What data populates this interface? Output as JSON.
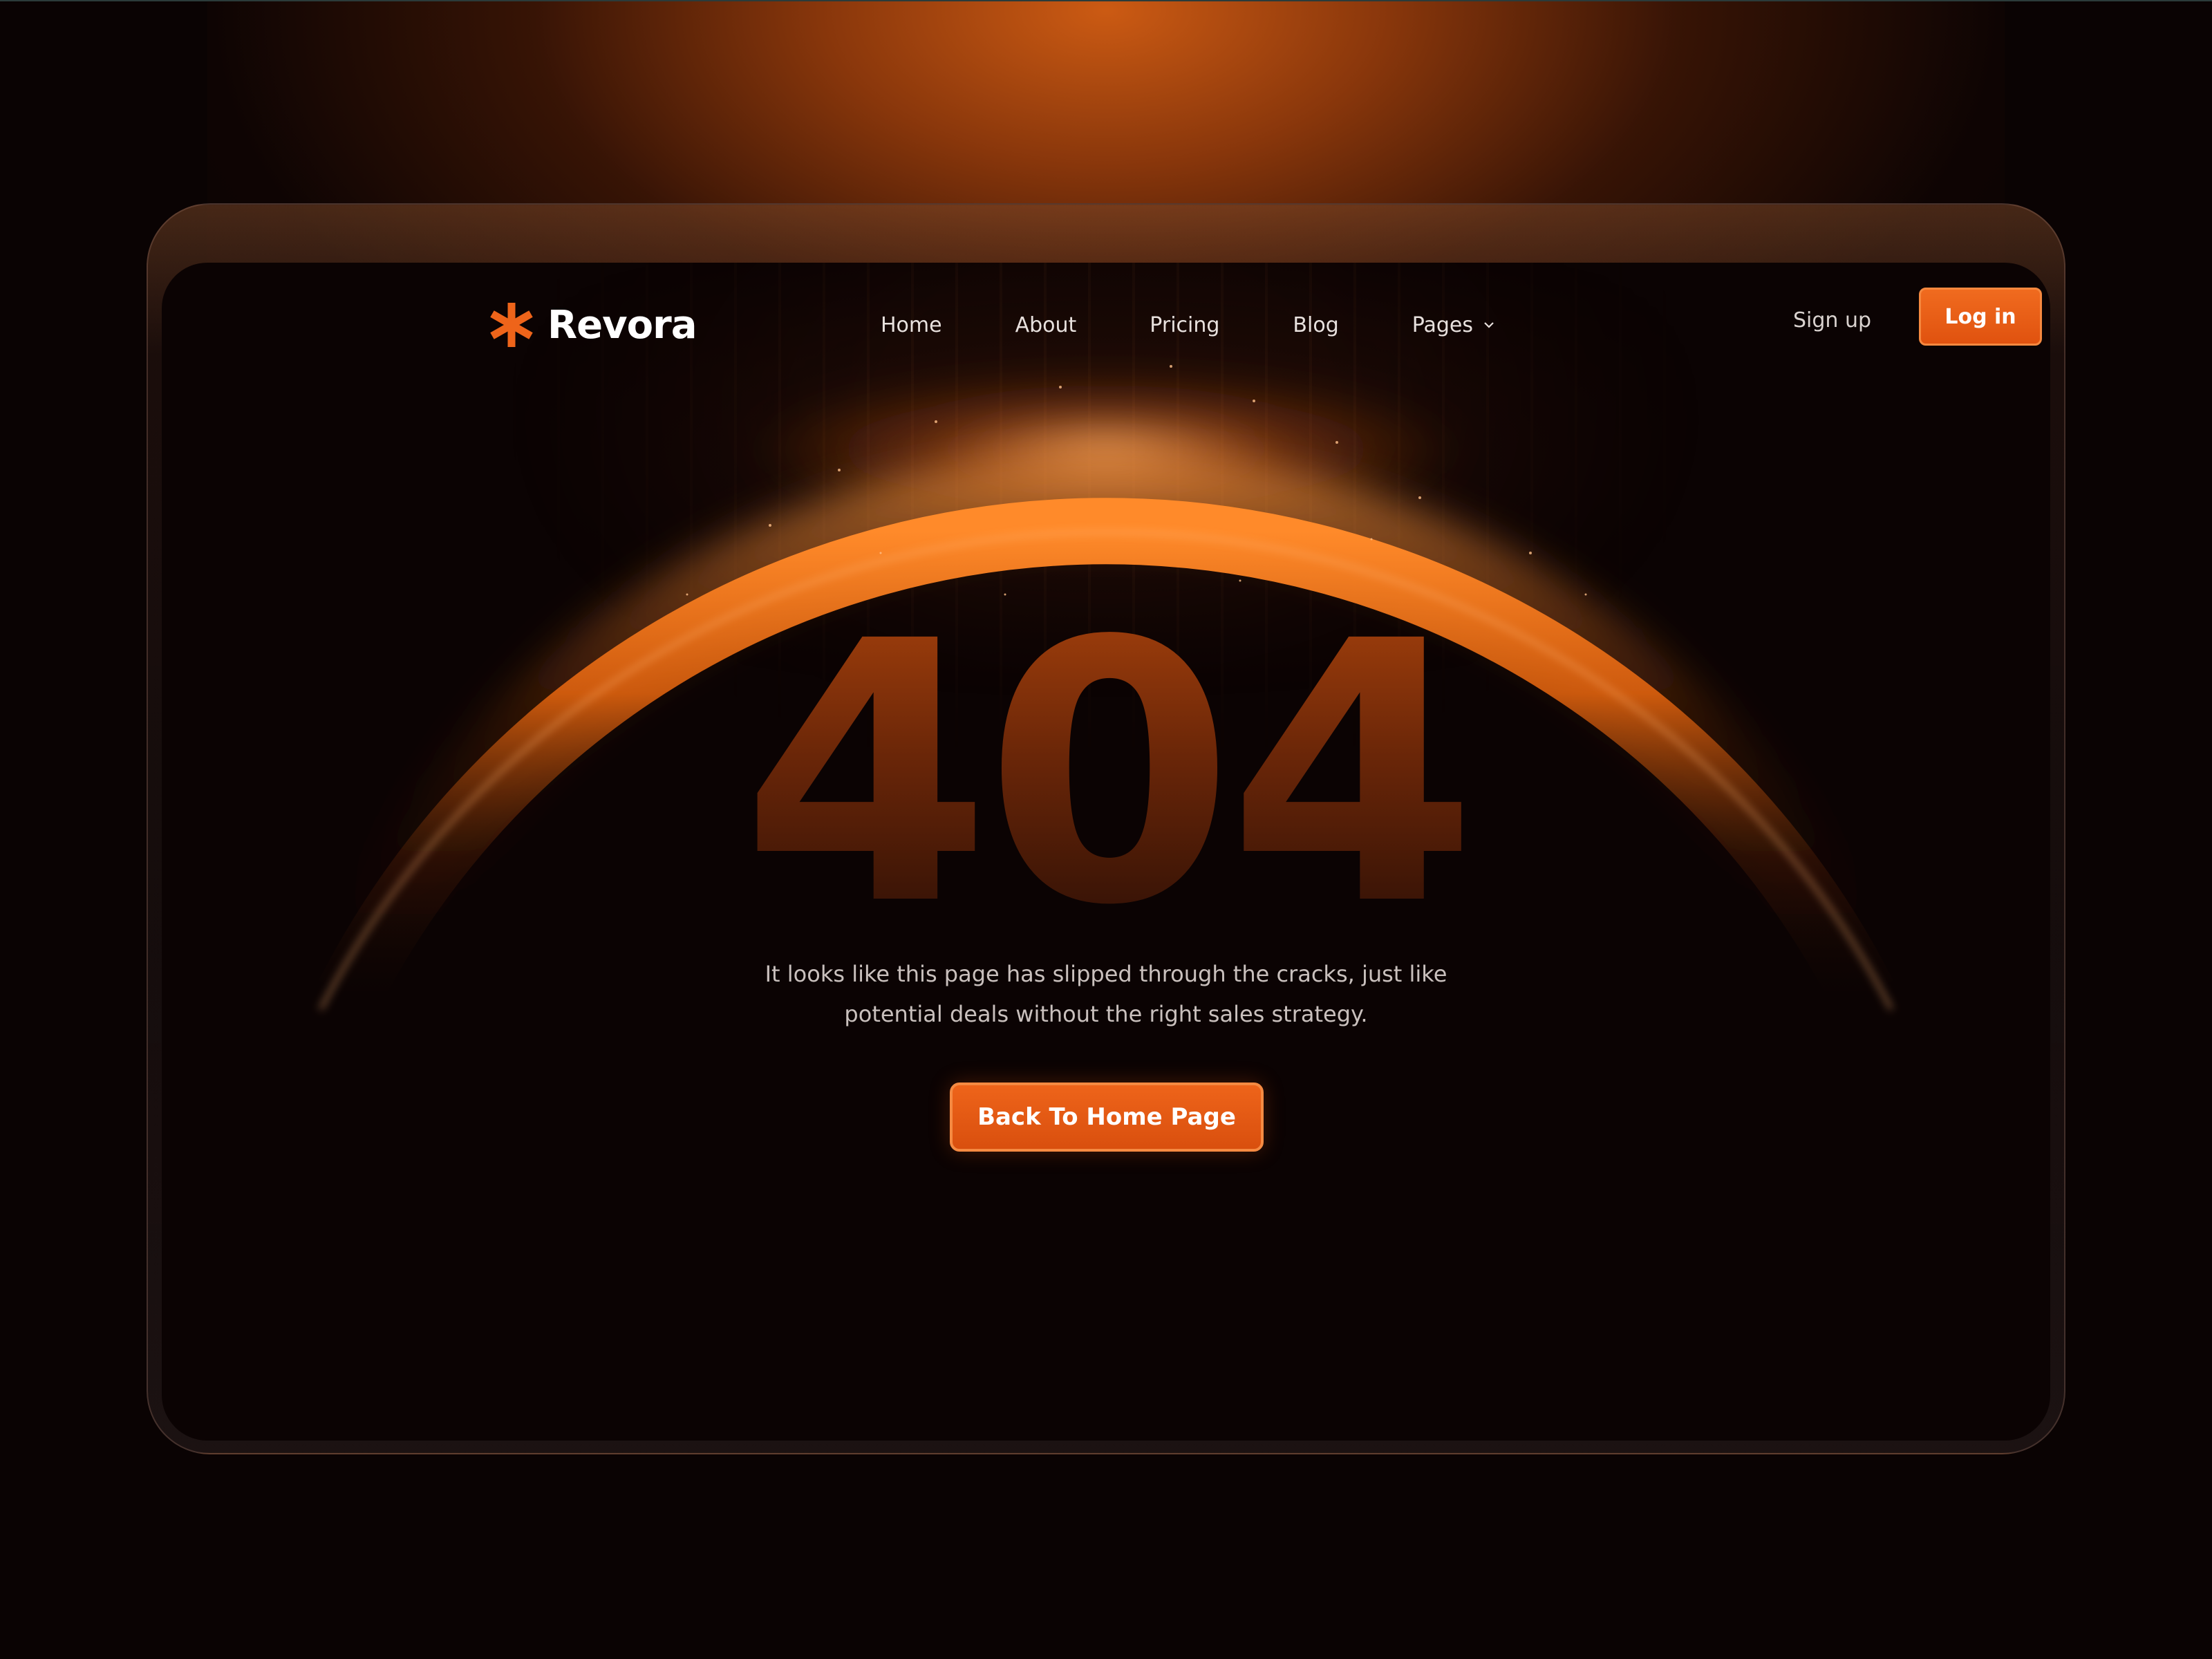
{
  "brand": {
    "name": "Revora",
    "accent": "#EE641A"
  },
  "nav": {
    "items": [
      {
        "label": "Home"
      },
      {
        "label": "About"
      },
      {
        "label": "Pricing"
      },
      {
        "label": "Blog"
      },
      {
        "label": "Pages",
        "icon": "chevron-down-icon"
      }
    ],
    "signup_label": "Sign up",
    "login_label": "Log in"
  },
  "error": {
    "code": "404",
    "message_line1": "It looks like this page has slipped through the cracks, just like",
    "message_line2": "potential deals without the right sales strategy.",
    "button_label": "Back To Home Page"
  }
}
